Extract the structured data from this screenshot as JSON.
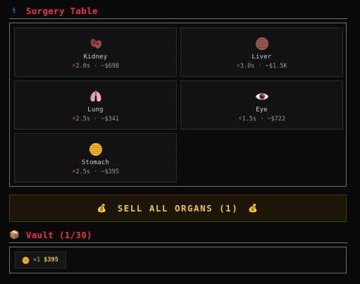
{
  "surgery": {
    "icon": "caduceus-icon",
    "title": "Surgery Table"
  },
  "organs": [
    {
      "name": "Kidney",
      "time": "2.0s",
      "price": "~$698",
      "icon": "kidney-icon"
    },
    {
      "name": "Liver",
      "time": "3.0s",
      "price": "~$1.5K",
      "icon": "liver-icon"
    },
    {
      "name": "Lung",
      "time": "2.5s",
      "price": "~$341",
      "icon": "lungs-icon"
    },
    {
      "name": "Eye",
      "time": "1.5s",
      "price": "~$722",
      "icon": "eye-icon"
    },
    {
      "name": "Stomach",
      "time": "2.5s",
      "price": "~$395",
      "icon": "stomach-icon"
    }
  ],
  "meta_separator": "·",
  "sell": {
    "label": "SELL ALL ORGANS (1)",
    "icon": "money-bag-icon"
  },
  "vault": {
    "icon": "package-icon",
    "title": "Vault (1/30)",
    "items": [
      {
        "icon": "stomach-icon",
        "qty": "×1",
        "price": "$395"
      }
    ]
  },
  "colors": {
    "accent_red": "#e8334b",
    "gold": "#f0c23a",
    "bolt": "#ff6a3d"
  }
}
